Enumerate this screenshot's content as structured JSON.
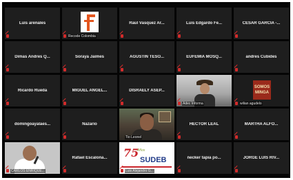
{
  "participants": [
    {
      "name": "Luis arenales"
    },
    {
      "caption": "Recode Colombia"
    },
    {
      "name": "Raul Vasquez Ar..."
    },
    {
      "name": "Luis Edgardo Fe..."
    },
    {
      "name": "CESAR GARCIA -..."
    },
    {
      "name": "Dimas Andres Q..."
    },
    {
      "name": "Soraya Jaimes"
    },
    {
      "name": "AGUSTIN TESO..."
    },
    {
      "name": "EUFEMIA MOSQ..."
    },
    {
      "name": "andres Cubides"
    },
    {
      "name": "Ricardo Rueda"
    },
    {
      "name": "MIGUEL ANGEL..."
    },
    {
      "name": "DISRAELY ASEP..."
    },
    {
      "caption": "Adec Informa"
    },
    {
      "caption": "wilian agudelo",
      "logo_text": [
        "SOMOS",
        "MINGA"
      ]
    },
    {
      "name": "domingoayalaes..."
    },
    {
      "name": "Nazario"
    },
    {
      "caption": "Tio Leonel"
    },
    {
      "name": "HECTOR LEAL"
    },
    {
      "name": "MARTHA ALFO..."
    },
    {
      "caption": "CARLOS ENRIQUE..."
    },
    {
      "name": "Rafael Escalona..."
    },
    {
      "caption": "Luis Alejandro G...",
      "logo_text": {
        "number": "75",
        "sub": "Años",
        "word": "SUDEB"
      }
    },
    {
      "name": "necker tapia po..."
    },
    {
      "name": "JORGE LUIS RIV..."
    }
  ],
  "colors": {
    "background": "#050505",
    "tile": "#1e1e1e",
    "active_speaker_border": "#a6c23b",
    "mic_muted": "#d12b2b"
  },
  "icons": {
    "muted": "mic-muted-icon"
  }
}
